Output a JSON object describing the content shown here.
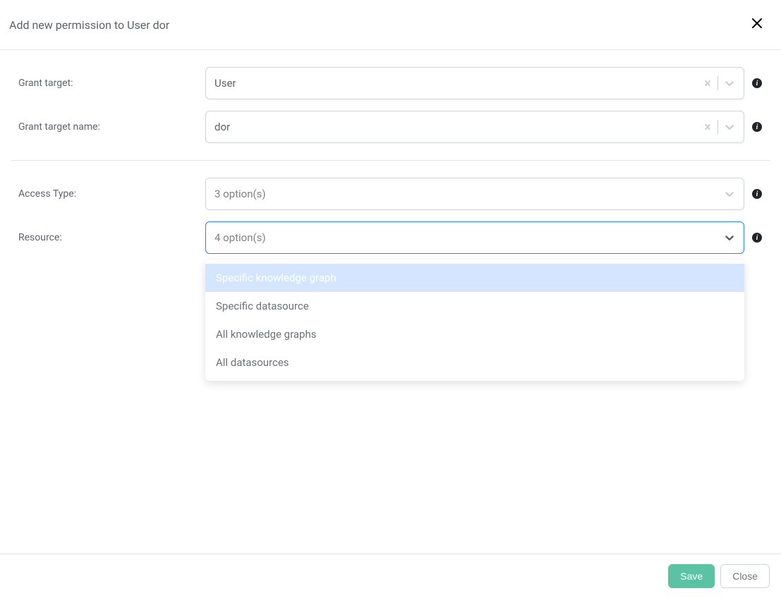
{
  "header": {
    "title": "Add new permission to User dor"
  },
  "form": {
    "grant_target": {
      "label": "Grant target:",
      "value": "User"
    },
    "grant_target_name": {
      "label": "Grant target name:",
      "value": "dor"
    },
    "access_type": {
      "label": "Access Type:",
      "placeholder": "3 option(s)"
    },
    "resource": {
      "label": "Resource:",
      "placeholder": "4 option(s)",
      "options": [
        "Specific knowledge graph",
        "Specific datasource",
        "All knowledge graphs",
        "All datasources"
      ]
    }
  },
  "footer": {
    "save": "Save",
    "close": "Close"
  },
  "icons": {
    "info": "i"
  }
}
